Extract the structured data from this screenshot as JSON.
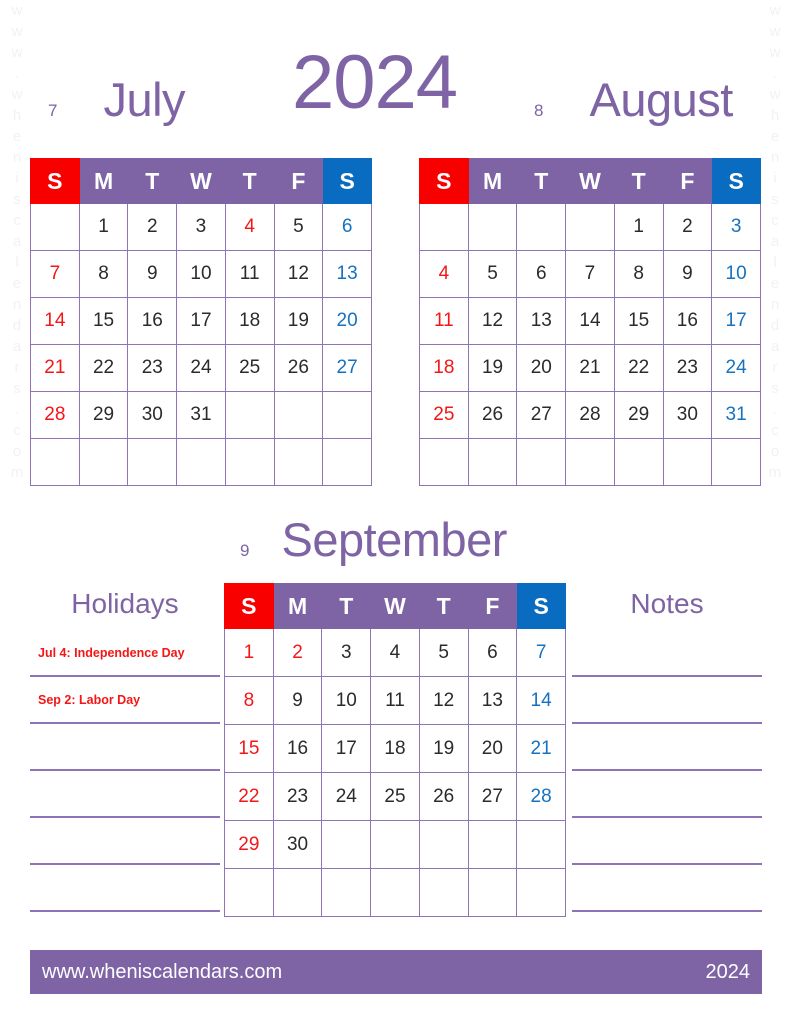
{
  "page": {
    "year_title": "2024",
    "watermark_text": "www.wheniscalendars.com"
  },
  "weekday_headers": [
    "S",
    "M",
    "T",
    "W",
    "T",
    "F",
    "S"
  ],
  "months": [
    {
      "number": "7",
      "name": "July",
      "weeks": [
        [
          {
            "d": "",
            "c": "red"
          },
          {
            "d": "1",
            "c": ""
          },
          {
            "d": "2",
            "c": ""
          },
          {
            "d": "3",
            "c": ""
          },
          {
            "d": "4",
            "c": "red"
          },
          {
            "d": "5",
            "c": ""
          },
          {
            "d": "6",
            "c": "blue"
          }
        ],
        [
          {
            "d": "7",
            "c": "red"
          },
          {
            "d": "8",
            "c": ""
          },
          {
            "d": "9",
            "c": ""
          },
          {
            "d": "10",
            "c": ""
          },
          {
            "d": "11",
            "c": ""
          },
          {
            "d": "12",
            "c": ""
          },
          {
            "d": "13",
            "c": "blue"
          }
        ],
        [
          {
            "d": "14",
            "c": "red"
          },
          {
            "d": "15",
            "c": ""
          },
          {
            "d": "16",
            "c": ""
          },
          {
            "d": "17",
            "c": ""
          },
          {
            "d": "18",
            "c": ""
          },
          {
            "d": "19",
            "c": ""
          },
          {
            "d": "20",
            "c": "blue"
          }
        ],
        [
          {
            "d": "21",
            "c": "red"
          },
          {
            "d": "22",
            "c": ""
          },
          {
            "d": "23",
            "c": ""
          },
          {
            "d": "24",
            "c": ""
          },
          {
            "d": "25",
            "c": ""
          },
          {
            "d": "26",
            "c": ""
          },
          {
            "d": "27",
            "c": "blue"
          }
        ],
        [
          {
            "d": "28",
            "c": "red"
          },
          {
            "d": "29",
            "c": ""
          },
          {
            "d": "30",
            "c": ""
          },
          {
            "d": "31",
            "c": ""
          },
          {
            "d": "",
            "c": ""
          },
          {
            "d": "",
            "c": ""
          },
          {
            "d": "",
            "c": "blue"
          }
        ],
        [
          {
            "d": "",
            "c": "red"
          },
          {
            "d": "",
            "c": ""
          },
          {
            "d": "",
            "c": ""
          },
          {
            "d": "",
            "c": ""
          },
          {
            "d": "",
            "c": ""
          },
          {
            "d": "",
            "c": ""
          },
          {
            "d": "",
            "c": "blue"
          }
        ]
      ]
    },
    {
      "number": "8",
      "name": "August",
      "weeks": [
        [
          {
            "d": "",
            "c": "red"
          },
          {
            "d": "",
            "c": ""
          },
          {
            "d": "",
            "c": ""
          },
          {
            "d": "",
            "c": ""
          },
          {
            "d": "1",
            "c": ""
          },
          {
            "d": "2",
            "c": ""
          },
          {
            "d": "3",
            "c": "blue"
          }
        ],
        [
          {
            "d": "4",
            "c": "red"
          },
          {
            "d": "5",
            "c": ""
          },
          {
            "d": "6",
            "c": ""
          },
          {
            "d": "7",
            "c": ""
          },
          {
            "d": "8",
            "c": ""
          },
          {
            "d": "9",
            "c": ""
          },
          {
            "d": "10",
            "c": "blue"
          }
        ],
        [
          {
            "d": "11",
            "c": "red"
          },
          {
            "d": "12",
            "c": ""
          },
          {
            "d": "13",
            "c": ""
          },
          {
            "d": "14",
            "c": ""
          },
          {
            "d": "15",
            "c": ""
          },
          {
            "d": "16",
            "c": ""
          },
          {
            "d": "17",
            "c": "blue"
          }
        ],
        [
          {
            "d": "18",
            "c": "red"
          },
          {
            "d": "19",
            "c": ""
          },
          {
            "d": "20",
            "c": ""
          },
          {
            "d": "21",
            "c": ""
          },
          {
            "d": "22",
            "c": ""
          },
          {
            "d": "23",
            "c": ""
          },
          {
            "d": "24",
            "c": "blue"
          }
        ],
        [
          {
            "d": "25",
            "c": "red"
          },
          {
            "d": "26",
            "c": ""
          },
          {
            "d": "27",
            "c": ""
          },
          {
            "d": "28",
            "c": ""
          },
          {
            "d": "29",
            "c": ""
          },
          {
            "d": "30",
            "c": ""
          },
          {
            "d": "31",
            "c": "blue"
          }
        ],
        [
          {
            "d": "",
            "c": "red"
          },
          {
            "d": "",
            "c": ""
          },
          {
            "d": "",
            "c": ""
          },
          {
            "d": "",
            "c": ""
          },
          {
            "d": "",
            "c": ""
          },
          {
            "d": "",
            "c": ""
          },
          {
            "d": "",
            "c": "blue"
          }
        ]
      ]
    },
    {
      "number": "9",
      "name": "September",
      "weeks": [
        [
          {
            "d": "1",
            "c": "red"
          },
          {
            "d": "2",
            "c": "red"
          },
          {
            "d": "3",
            "c": ""
          },
          {
            "d": "4",
            "c": ""
          },
          {
            "d": "5",
            "c": ""
          },
          {
            "d": "6",
            "c": ""
          },
          {
            "d": "7",
            "c": "blue"
          }
        ],
        [
          {
            "d": "8",
            "c": "red"
          },
          {
            "d": "9",
            "c": ""
          },
          {
            "d": "10",
            "c": ""
          },
          {
            "d": "11",
            "c": ""
          },
          {
            "d": "12",
            "c": ""
          },
          {
            "d": "13",
            "c": ""
          },
          {
            "d": "14",
            "c": "blue"
          }
        ],
        [
          {
            "d": "15",
            "c": "red"
          },
          {
            "d": "16",
            "c": ""
          },
          {
            "d": "17",
            "c": ""
          },
          {
            "d": "18",
            "c": ""
          },
          {
            "d": "19",
            "c": ""
          },
          {
            "d": "20",
            "c": ""
          },
          {
            "d": "21",
            "c": "blue"
          }
        ],
        [
          {
            "d": "22",
            "c": "red"
          },
          {
            "d": "23",
            "c": ""
          },
          {
            "d": "24",
            "c": ""
          },
          {
            "d": "25",
            "c": ""
          },
          {
            "d": "26",
            "c": ""
          },
          {
            "d": "27",
            "c": ""
          },
          {
            "d": "28",
            "c": "blue"
          }
        ],
        [
          {
            "d": "29",
            "c": "red"
          },
          {
            "d": "30",
            "c": ""
          },
          {
            "d": "",
            "c": ""
          },
          {
            "d": "",
            "c": ""
          },
          {
            "d": "",
            "c": ""
          },
          {
            "d": "",
            "c": ""
          },
          {
            "d": "",
            "c": "blue"
          }
        ],
        [
          {
            "d": "",
            "c": "red"
          },
          {
            "d": "",
            "c": ""
          },
          {
            "d": "",
            "c": ""
          },
          {
            "d": "",
            "c": ""
          },
          {
            "d": "",
            "c": ""
          },
          {
            "d": "",
            "c": ""
          },
          {
            "d": "",
            "c": "blue"
          }
        ]
      ]
    }
  ],
  "holidays": {
    "title": "Holidays",
    "entries": [
      "Jul 4: Independence Day",
      "Sep 2: Labor Day",
      "",
      "",
      "",
      ""
    ]
  },
  "notes": {
    "title": "Notes",
    "entries": [
      "",
      "",
      "",
      "",
      "",
      ""
    ]
  },
  "footer": {
    "website": "www.wheniscalendars.com",
    "year": "2024"
  },
  "colors": {
    "purple": "#7e63a5",
    "sunday_red": "#f80000",
    "saturday_blue": "#0a6cc0",
    "date_red": "#f41616",
    "date_blue": "#1572c0",
    "grid_line": "#8f74b5"
  }
}
